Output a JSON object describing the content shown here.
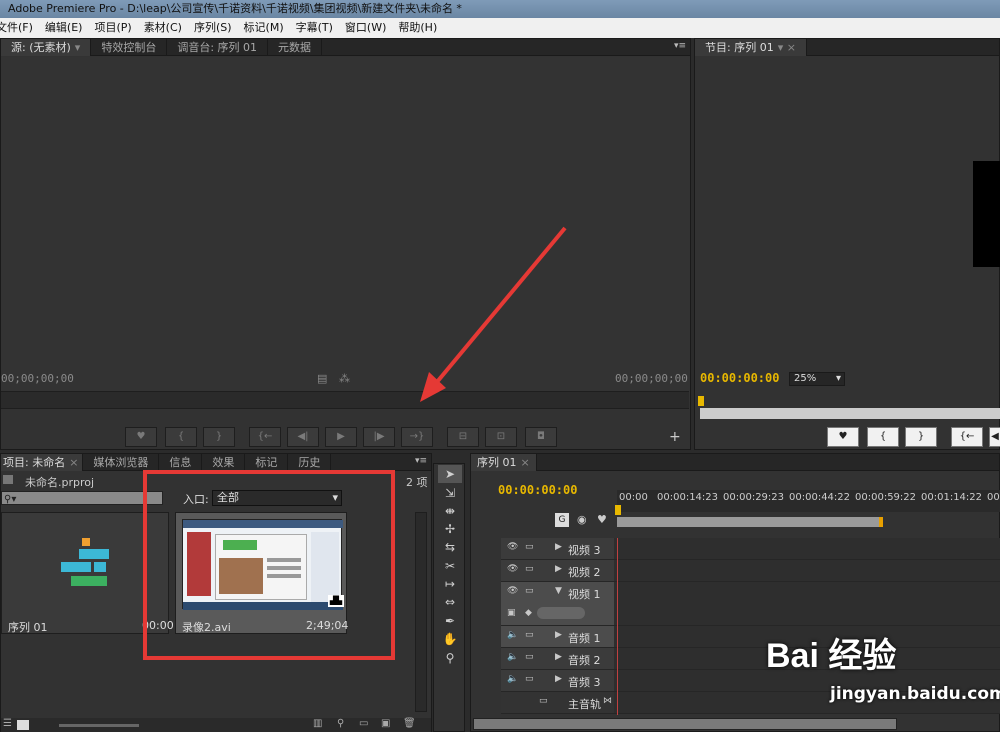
{
  "window": {
    "title": "Adobe Premiere Pro - D:\\leap\\公司宣传\\千诺资料\\千诺视频\\集团视频\\新建文件夹\\未命名 *"
  },
  "menu": [
    "文件(F)",
    "编辑(E)",
    "项目(P)",
    "素材(C)",
    "序列(S)",
    "标记(M)",
    "字幕(T)",
    "窗口(W)",
    "帮助(H)"
  ],
  "source_panel": {
    "tabs": [
      "源: (无素材)",
      "特效控制台",
      "调音台: 序列 01",
      "元数据"
    ],
    "timecode_left": "00;00;00;00",
    "timecode_right": "00;00;00;00"
  },
  "program_panel": {
    "tab": "节目: 序列 01",
    "timecode": "00:00:00:00",
    "zoom": "25%"
  },
  "project_panel": {
    "tabs": [
      "项目: 未命名",
      "媒体浏览器",
      "信息",
      "效果",
      "标记",
      "历史"
    ],
    "item_count": "2 项",
    "project_file": "未命名.prproj",
    "inpoint_label": "入口:",
    "inpoint_value": "全部",
    "items": [
      {
        "name": "序列 01",
        "duration": "00:00"
      },
      {
        "name": "录像2.avi",
        "duration": "2;49;04"
      }
    ]
  },
  "timeline": {
    "tab": "序列 01",
    "timecode": "00:00:00:00",
    "ruler": [
      "00:00",
      "00:00:14:23",
      "00:00:29:23",
      "00:00:44:22",
      "00:00:59:22",
      "00:01:14:22",
      "00:0"
    ],
    "tracks": [
      {
        "name": "视频 3",
        "type": "video"
      },
      {
        "name": "视频 2",
        "type": "video"
      },
      {
        "name": "视频 1",
        "type": "video"
      },
      {
        "name": "音频 1",
        "type": "audio"
      },
      {
        "name": "音频 2",
        "type": "audio"
      },
      {
        "name": "音频 3",
        "type": "audio"
      },
      {
        "name": "主音轨",
        "type": "master"
      }
    ]
  },
  "watermark": {
    "text": "jingyan.baidu.com",
    "logo": "Bai 经验"
  },
  "colors": {
    "timecode": "#e8b800",
    "highlight": "#e53935",
    "panel": "#323232"
  }
}
